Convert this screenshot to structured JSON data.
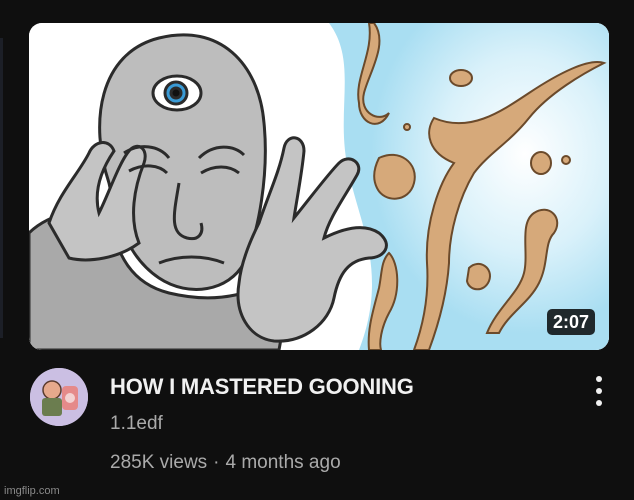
{
  "video": {
    "title": "HOW I MASTERED GOONING",
    "channel": "1.1edf",
    "views": "285K views",
    "separator": "·",
    "age": "4 months ago",
    "duration": "2:07"
  },
  "watermark": "imgflip.com",
  "icons": {
    "more": "vertical-ellipsis-icon"
  },
  "colors": {
    "background": "#0f0f0f",
    "title": "#f1f1f1",
    "secondary_text": "#aaaaaa",
    "badge_bg": "#000000"
  }
}
